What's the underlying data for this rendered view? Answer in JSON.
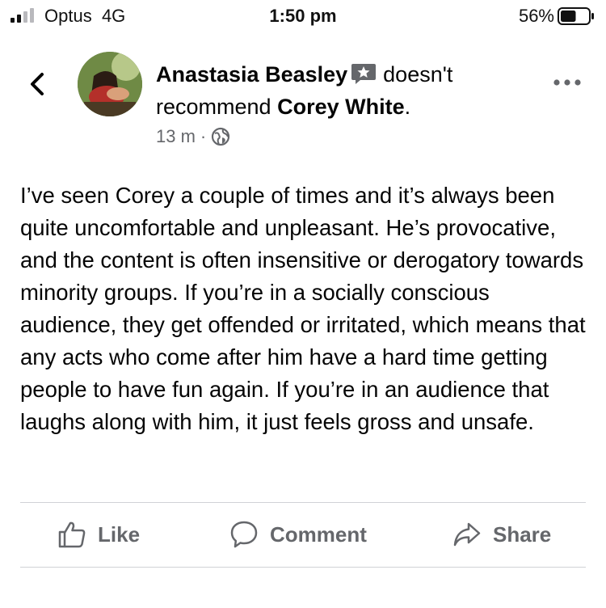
{
  "status_bar": {
    "carrier": "Optus",
    "network": "4G",
    "time": "1:50 pm",
    "battery_percent": "56%",
    "battery_level": 0.56
  },
  "post": {
    "author": "Anastasia Beasley",
    "verb": "doesn't",
    "verb2": "recommend",
    "subject": "Corey White",
    "punct": ".",
    "time_ago": "13 m",
    "separator": "·",
    "privacy_icon": "globe-icon",
    "badge_icon": "recommendation-badge-icon",
    "body": "I’ve seen Corey a couple of times and it’s always been quite uncomfortable and unpleasant. He’s provocative, and the content is often insensitive or derogatory towards minority groups. If you’re in a socially conscious audience, they get offended or irritated, which means that any acts who come after him have a hard time getting people to have fun again. If you’re in an audience that laughs along with him, it just feels gross and unsafe."
  },
  "actions": {
    "like": "Like",
    "comment": "Comment",
    "share": "Share"
  },
  "colors": {
    "text": "#050505",
    "secondary": "#65676b",
    "divider": "#d0d2d6"
  }
}
